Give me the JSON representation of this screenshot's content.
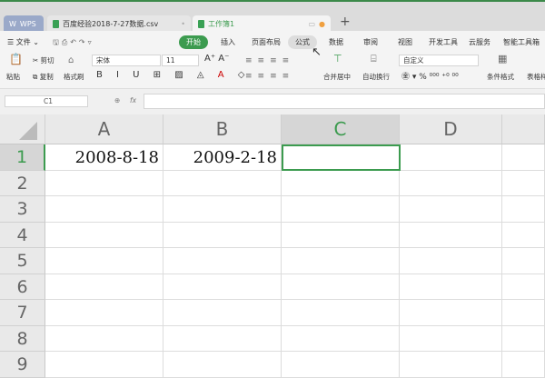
{
  "tabs": [
    {
      "label": "WPS"
    },
    {
      "label": "百度经验2018-7-27数据.csv"
    },
    {
      "label": "工作簿1"
    }
  ],
  "new_tab": "+",
  "menu": {
    "file": "文件",
    "items": [
      "开始",
      "插入",
      "页面布局",
      "公式",
      "数据",
      "审阅",
      "视图",
      "开发工具",
      "云服务",
      "智能工具箱"
    ]
  },
  "ribbon": {
    "paste": "粘贴",
    "cut": "剪切",
    "copy": "复制",
    "format_painter": "格式刷",
    "font": "宋体",
    "size": "11",
    "merge": "合并居中",
    "wrap": "自动换行",
    "number_format": "自定义",
    "cond_format": "条件格式",
    "table_style": "表格样"
  },
  "formula_bar": {
    "cell_ref": "C1",
    "fx": "fx",
    "value": ""
  },
  "columns": [
    "A",
    "B",
    "C",
    "D"
  ],
  "rows": [
    "1",
    "2",
    "3",
    "4",
    "5",
    "6",
    "7",
    "8",
    "9"
  ],
  "cells": {
    "A1": "2008-8-18",
    "B1": "2009-2-18"
  },
  "accent": "#3c9b4f"
}
